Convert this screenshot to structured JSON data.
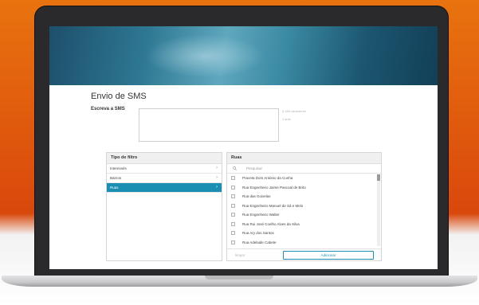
{
  "page": {
    "title": "Envio de SMS",
    "sms_label": "Escreva a SMS",
    "chars_note": "§ 160 caracteres",
    "sms_note": "1 sms"
  },
  "filter_panel": {
    "title": "Tipo de filtro",
    "items": [
      {
        "label": "Interessés",
        "active": false
      },
      {
        "label": "Bairros",
        "active": false
      },
      {
        "label": "Ruas",
        "active": true
      }
    ]
  },
  "streets_panel": {
    "title": "Ruas",
    "search_placeholder": "Pesquisar",
    "items": [
      "Praceta Dom António da Cunha",
      "Rua Engenheiro Jaime Pascoal de Brito",
      "Rua das Goivelas",
      "Rua Engenheiro Manuel de Sá e Melo",
      "Rua Engenheiro Walter",
      "Rua Rui José Coelho Alves da Silva",
      "Rua Ary dos Santos",
      "Rua Adelaide Cabete"
    ],
    "clear_label": "limpar",
    "add_label": "Adicionar"
  },
  "colors": {
    "accent": "#1b8fb1",
    "background_orange": "#e05a0d"
  },
  "icons": {
    "search": "search-icon",
    "chevron": "chevron-right-icon"
  }
}
